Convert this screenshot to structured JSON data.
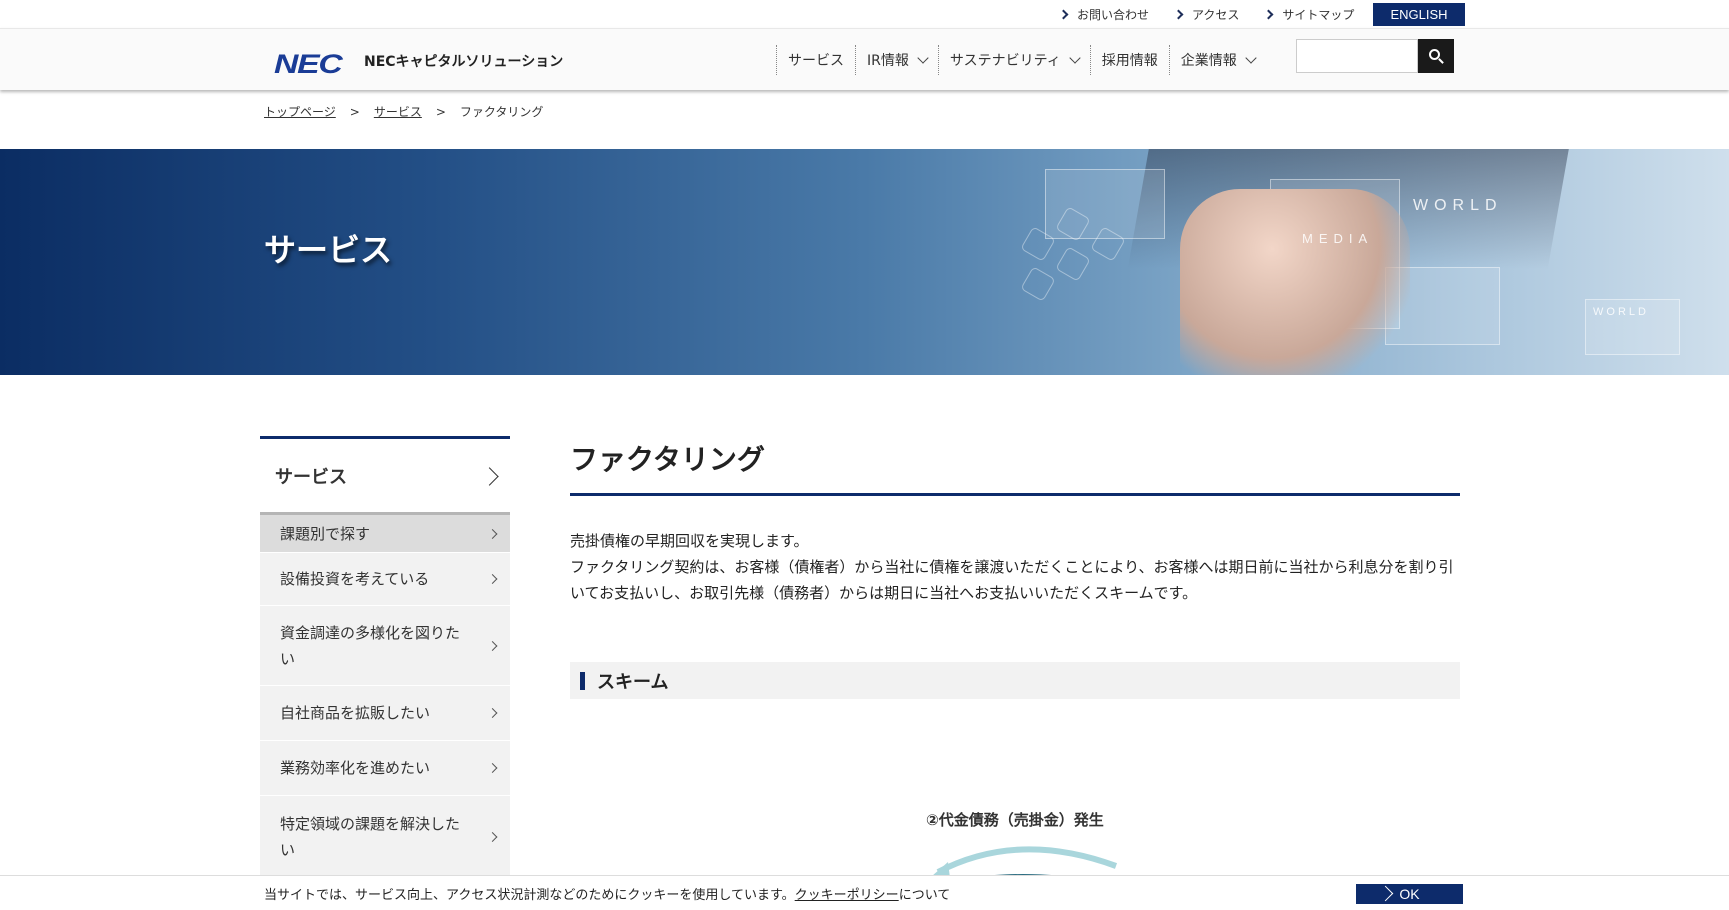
{
  "utility": {
    "links": [
      {
        "label": "お問い合わせ"
      },
      {
        "label": "アクセス"
      },
      {
        "label": "サイトマップ"
      }
    ],
    "english_label": "ENGLISH"
  },
  "header": {
    "logo_text": "NEC",
    "company_name": "NECキャピタルソリューション",
    "nav": [
      {
        "label": "サービス",
        "dropdown": false
      },
      {
        "label": "IR情報",
        "dropdown": true
      },
      {
        "label": "サステナビリティ",
        "dropdown": true
      },
      {
        "label": "採用情報",
        "dropdown": false
      },
      {
        "label": "企業情報",
        "dropdown": true
      }
    ],
    "search_value": ""
  },
  "breadcrumb": {
    "items": [
      "トップページ",
      "サービス"
    ],
    "current": "ファクタリング",
    "separator": ">"
  },
  "hero": {
    "title": "サービス",
    "overlay_words": [
      "WORLD",
      "MEDIA",
      "WORLD"
    ]
  },
  "sidebar": {
    "heading": "サービス",
    "items": [
      {
        "label": "課題別で探す",
        "active": true
      },
      {
        "label": "設備投資を考えている",
        "active": false
      },
      {
        "label": "資金調達の多様化を図りたい",
        "active": false
      },
      {
        "label": "自社商品を拡販したい",
        "active": false
      },
      {
        "label": "業務効率化を進めたい",
        "active": false
      },
      {
        "label": "特定領域の課題を解決したい",
        "active": false
      }
    ]
  },
  "main": {
    "title": "ファクタリング",
    "lead_lines": [
      "売掛債権の早期回収を実現します。",
      "ファクタリング契約は、お客様（債権者）から当社に債権を譲渡いただくことにより、お客様へは期日前に当社から利息分を割り引いてお支払いし、お取引先様（債務者）からは期日に当社へお支払いいただくスキームです。"
    ],
    "section_heading": "スキーム",
    "diagram_label": "②代金債務（売掛金）発生"
  },
  "cookie": {
    "text_before": "当サイトでは、サービス向上、アクセス状況計測などのためにクッキーを使用しています。",
    "policy_link": "クッキーポリシー",
    "text_after": "について",
    "ok_label": "OK"
  },
  "colors": {
    "brand_navy": "#0d2b6b",
    "logo_blue": "#1a3c96",
    "diagram_green": "#3a8c6a",
    "diagram_teal": "#2d6e82",
    "diagram_red": "#a33a4a",
    "diagram_arrow": "#a9d6dc"
  }
}
